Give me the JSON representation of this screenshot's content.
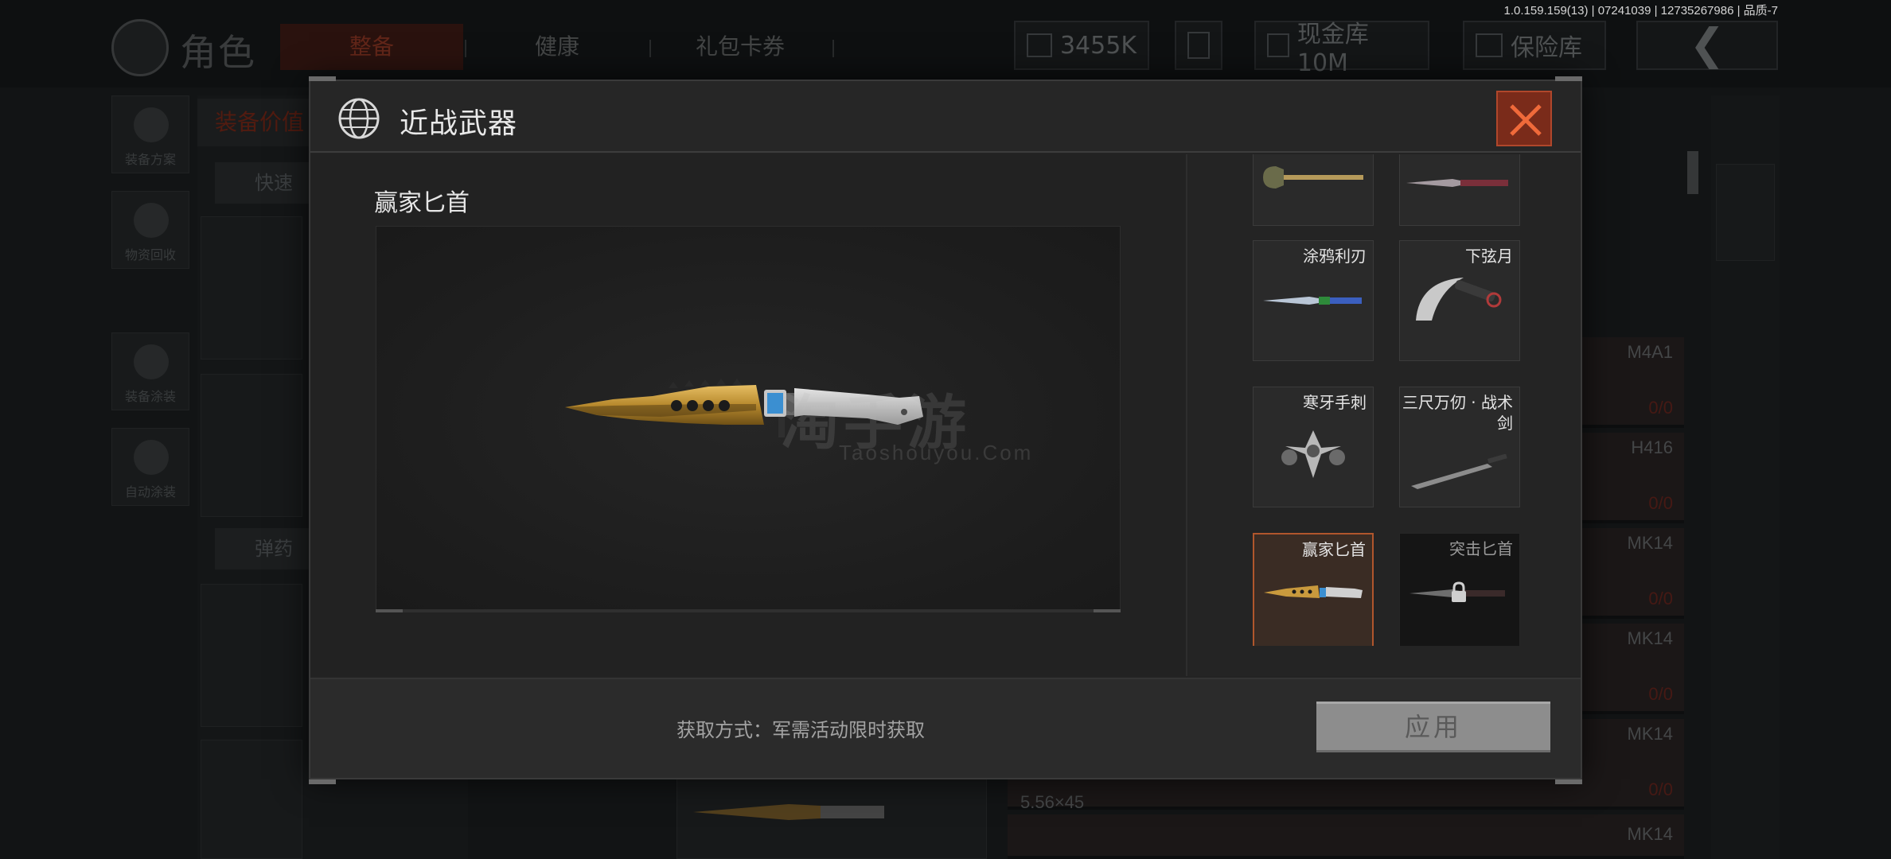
{
  "build_info": "1.0.159.159(13) | 07241039 | 12735267986 | 品质-7",
  "background": {
    "role_title": "角色",
    "tabs": [
      "整备",
      "健康",
      "礼包卡券"
    ],
    "money": "3455K",
    "cash_vault": "现金库 10M",
    "safe_vault": "保险库",
    "side_tiles": [
      "装备方案",
      "物资回收",
      "装备涂装",
      "自动涂装"
    ],
    "panel_heading": "装备价值",
    "quick_pill": "快速",
    "ammo_pill": "弹药",
    "weapon_rows": [
      {
        "name": "M4A1",
        "count": "0/0"
      },
      {
        "name": "H416",
        "count": "0/0"
      },
      {
        "name": "MK14",
        "count": "0/0"
      },
      {
        "name": "MK14",
        "count": "0/0"
      },
      {
        "name": "MK14",
        "count": "0/0"
      },
      {
        "name": "MK14",
        "count": ""
      }
    ],
    "ammo_label": "5.56×45"
  },
  "modal": {
    "title": "近战武器",
    "selected_item_name": "赢家匕首",
    "watermark_main": "淘手游",
    "watermark_sub": "Taoshouyou.Com",
    "items": [
      {
        "name": "",
        "icon": "shovel-icon",
        "state": "normal"
      },
      {
        "name": "",
        "icon": "knife-icon",
        "state": "normal"
      },
      {
        "name": "涂鸦利刃",
        "icon": "knife-icon",
        "state": "normal"
      },
      {
        "name": "下弦月",
        "icon": "karambit-icon",
        "state": "normal"
      },
      {
        "name": "寒牙手刺",
        "icon": "claw-icon",
        "state": "normal"
      },
      {
        "name": "三尺万仞 · 战术剑",
        "icon": "sword-icon",
        "state": "normal"
      },
      {
        "name": "赢家匕首",
        "icon": "dagger-icon",
        "state": "selected"
      },
      {
        "name": "突击匕首",
        "icon": "lock-icon",
        "state": "locked"
      }
    ],
    "source_text": "获取方式：军需活动限时获取",
    "apply_label": "应用"
  },
  "colors": {
    "accent_orange": "#b0562c",
    "close_bg": "#7a2b1a",
    "apply_bg": "#8d8d8d",
    "gold": "#c99a3d"
  }
}
